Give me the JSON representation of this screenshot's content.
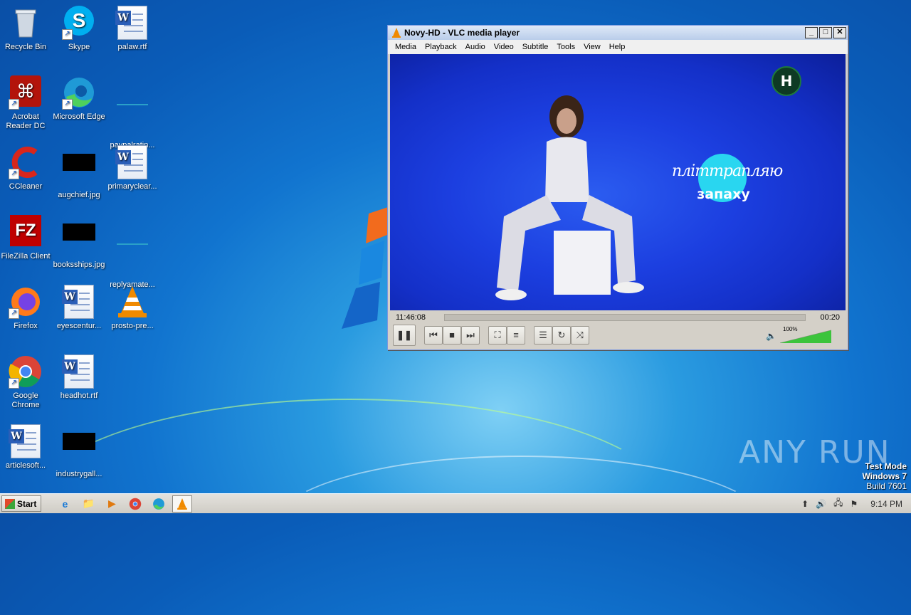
{
  "desktop": {
    "icons": [
      {
        "label": "Recycle Bin"
      },
      {
        "label": "Skype"
      },
      {
        "label": "palaw.rtf"
      },
      {
        "label": "Acrobat Reader DC"
      },
      {
        "label": "Microsoft Edge"
      },
      {
        "label": "paypalratin..."
      },
      {
        "label": "CCleaner"
      },
      {
        "label": "augchief.jpg"
      },
      {
        "label": "primaryclear..."
      },
      {
        "label": "FileZilla Client"
      },
      {
        "label": "booksships.jpg"
      },
      {
        "label": "replyamate..."
      },
      {
        "label": "Firefox"
      },
      {
        "label": "eyescentur..."
      },
      {
        "label": "prosto-pre..."
      },
      {
        "label": "Google Chrome"
      },
      {
        "label": "headhot.rtf"
      },
      {
        "label": "articlesoft..."
      },
      {
        "label": "industrygall..."
      }
    ]
  },
  "vlc": {
    "title": "Novy-HD - VLC media player",
    "menu": [
      "Media",
      "Playback",
      "Audio",
      "Video",
      "Subtitle",
      "Tools",
      "View",
      "Help"
    ],
    "video_overlay": {
      "logo": "H",
      "line1": "пліттрапляю",
      "line2": "запаху"
    },
    "elapsed": "11:46:08",
    "remaining": "00:20",
    "progress": 0.0,
    "volume_label": "100%",
    "volume": 1.0
  },
  "taskbar": {
    "start_label": "Start",
    "clock": "9:14 PM"
  },
  "watermark": {
    "text": "ANY RUN"
  },
  "test_mode": {
    "line1": "Test Mode",
    "line2": "Windows 7",
    "line3": "Build 7601"
  }
}
